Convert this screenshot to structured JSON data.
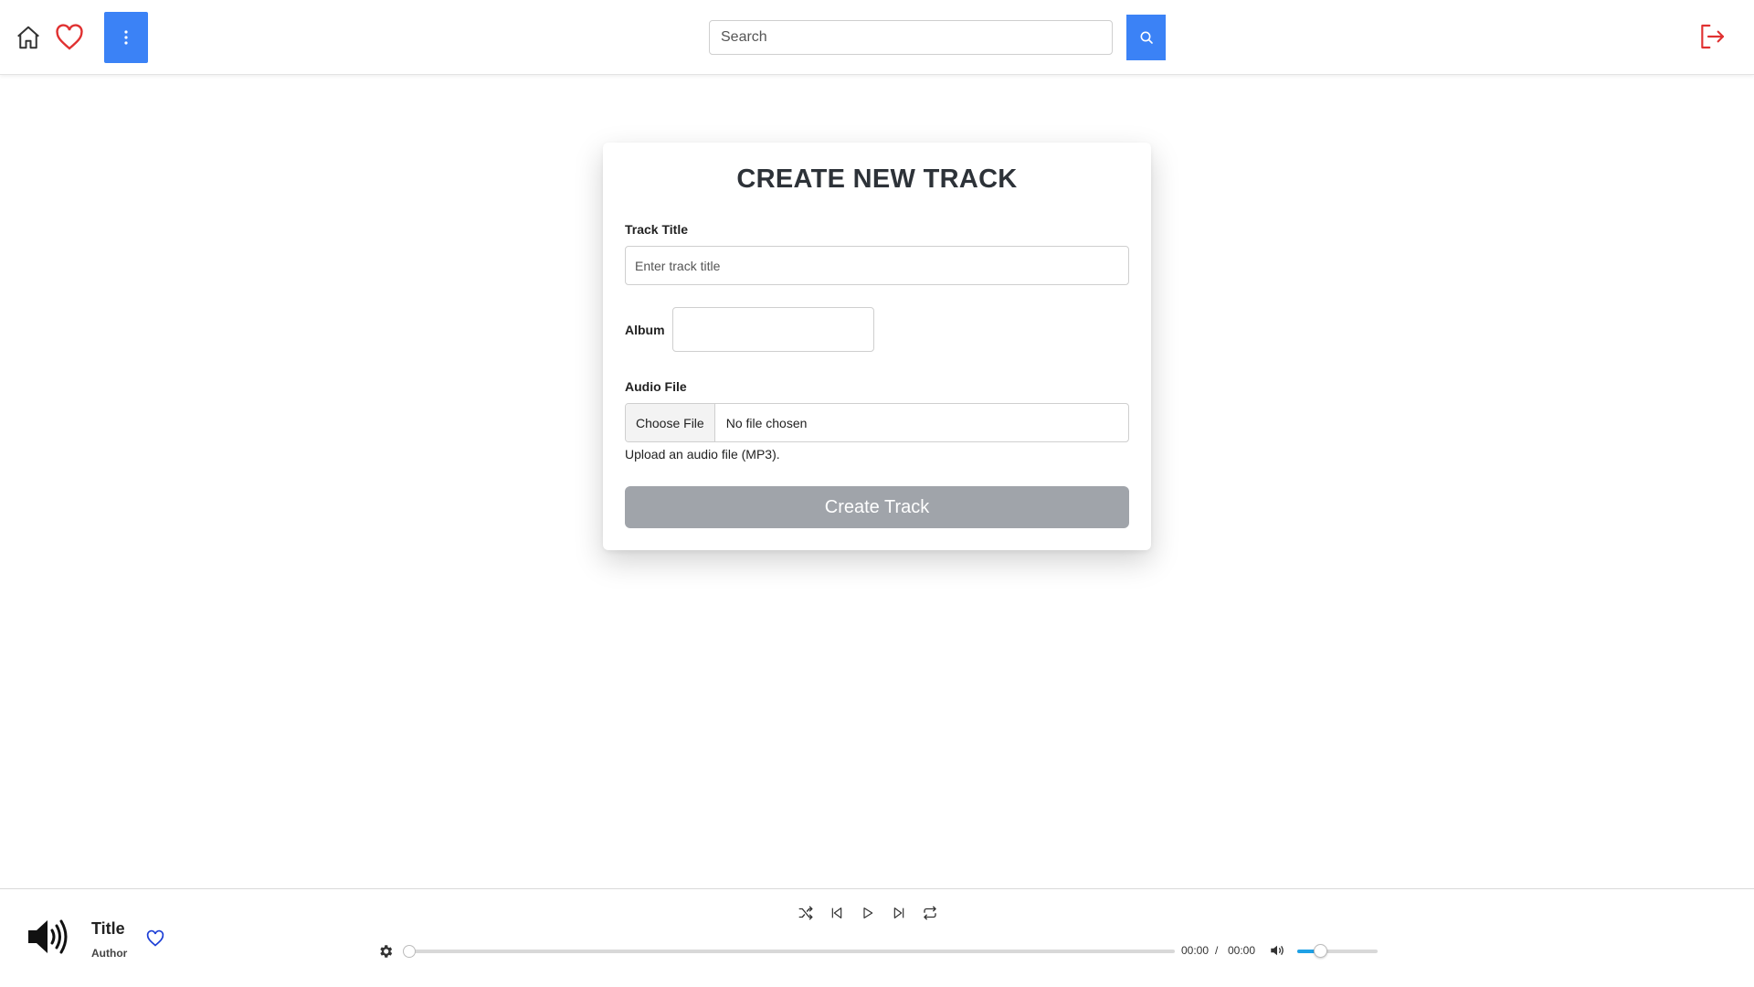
{
  "nav": {
    "search_placeholder": "Search",
    "icons": [
      "home-icon",
      "heart-icon",
      "kebab-menu-icon",
      "search-icon",
      "logout-icon"
    ],
    "colors": {
      "accent": "#3b82f6",
      "favorite": "#e03131",
      "logout": "#e03131"
    }
  },
  "form": {
    "heading": "CREATE NEW TRACK",
    "track_title_label": "Track Title",
    "track_title_placeholder": "Enter track title",
    "album_label": "Album",
    "album_value": "",
    "audio_label": "Audio File",
    "choose_file_label": "Choose File",
    "file_status": "No file chosen",
    "help_text": "Upload an audio file (MP3).",
    "submit_label": "Create Track",
    "submit_color": "#a0a4aa"
  },
  "player": {
    "title": "Title",
    "author": "Author",
    "current_time": "00:00",
    "separator": "/",
    "duration": "00:00",
    "progress": 0,
    "volume": 0.28,
    "controls": [
      "shuffle-icon",
      "previous-icon",
      "play-icon",
      "next-icon",
      "repeat-icon"
    ],
    "colors": {
      "volume_fill": "#1ea1e6",
      "like": "#1d3fd6"
    }
  }
}
